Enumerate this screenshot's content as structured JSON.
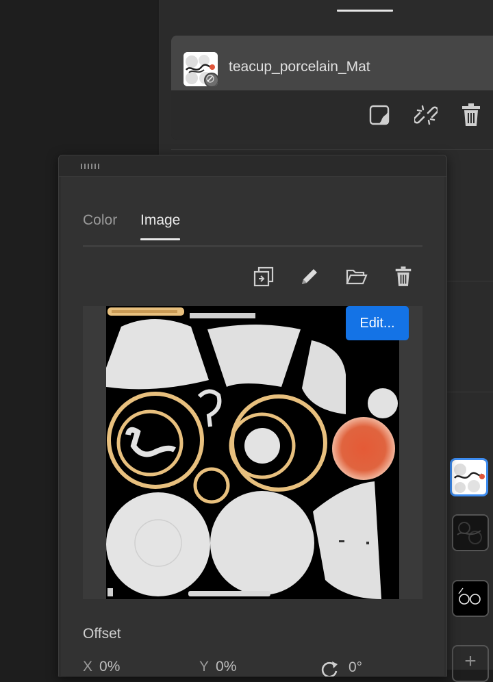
{
  "material": {
    "name": "teacup_porcelain_Mat"
  },
  "material_actions": [
    {
      "name": "duplicate-material-button",
      "icon": "sticky-note-icon"
    },
    {
      "name": "unlink-button",
      "icon": "broken-link-icon"
    },
    {
      "name": "delete-material-button",
      "icon": "trash-icon"
    }
  ],
  "popup": {
    "tabs": [
      {
        "label": "Color",
        "selected": false
      },
      {
        "label": "Image",
        "selected": true
      }
    ],
    "toolbar": [
      {
        "name": "replace-image-button",
        "icon": "replace-image-icon"
      },
      {
        "name": "edit-image-button",
        "icon": "pencil-icon"
      },
      {
        "name": "open-folder-button",
        "icon": "folder-open-icon"
      },
      {
        "name": "delete-image-button",
        "icon": "trash-icon"
      }
    ],
    "edit_button_label": "Edit...",
    "offset": {
      "label": "Offset",
      "x_label": "X",
      "x_value": "0%",
      "y_label": "Y",
      "y_value": "0%",
      "rotation_icon": "rotate-icon",
      "rotation_value": "0°"
    }
  },
  "texture_slots": [
    {
      "name": "texture-slot-basecolor",
      "active": true
    },
    {
      "name": "texture-slot-normal",
      "active": false
    },
    {
      "name": "texture-slot-roughness",
      "active": false
    }
  ],
  "add_slot_label": "+",
  "colors": {
    "accent": "#1473e6",
    "active_outline": "#3d8cf0",
    "gold": "#e8c07e",
    "orange": "#e0553a"
  }
}
